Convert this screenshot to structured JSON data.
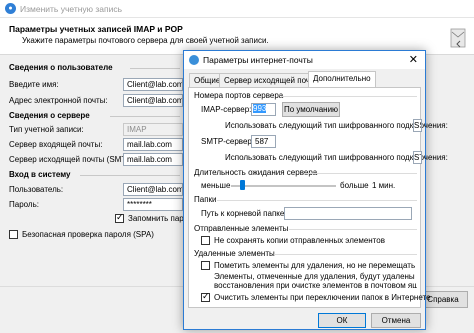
{
  "window": {
    "title": "Изменить учетную запись",
    "header_title": "Параметры учетных записей IMAP и POP",
    "header_subtitle": "Укажите параметры почтового сервера для своей учетной записи."
  },
  "user_section": {
    "heading": "Сведения о пользователе",
    "name_label": "Введите имя:",
    "name_value": "Client@lab.com",
    "email_label": "Адрес электронной почты:",
    "email_value": "Client@lab.com"
  },
  "server_section": {
    "heading": "Сведения о сервере",
    "type_label": "Тип учетной записи:",
    "type_value": "IMAP",
    "incoming_label": "Сервер входящей почты:",
    "incoming_value": "mail.lab.com",
    "outgoing_label": "Сервер исходящей почты (SMTP):",
    "outgoing_value": "mail.lab.com"
  },
  "login_section": {
    "heading": "Вход в систему",
    "user_label": "Пользователь:",
    "user_value": "Client@lab.com",
    "password_label": "Пароль:",
    "password_value": "********",
    "remember_label": "Запомнить пароль",
    "spa_label": "Безопасная проверка пароля (SPA)"
  },
  "footer": {
    "help_label": "Справка"
  },
  "dialog": {
    "title": "Параметры интернет-почты",
    "close": "✕",
    "tabs": [
      "Общие",
      "Сервер исходящей почты",
      "Дополнительно"
    ],
    "ports_group": "Номера портов сервера",
    "imap_label": "IMAP-сервер:",
    "imap_value": "993",
    "default_button": "По умолчанию",
    "enc_label_1": "Использовать следующий тип шифрованного подключения:",
    "enc_value_1": "SS",
    "smtp_label": "SMTP-сервер:",
    "smtp_value": "587",
    "enc_label_2": "Использовать следующий тип шифрованного подключения:",
    "enc_value_2": "ST",
    "timeout_group": "Длительность ожидания сервера",
    "timeout_less": "меньше",
    "timeout_more": "больше",
    "timeout_value": "1 мин.",
    "timeout_level": 0.1,
    "folders_group": "Папки",
    "root_folder_label": "Путь к корневой папке:",
    "sent_group": "Отправленные элементы",
    "sent_checkbox": "Не сохранять копии отправленных элементов",
    "deleted_group": "Удаленные элементы",
    "deleted_checkbox_1": "Пометить элементы для удаления, но не перемещать их автоматич",
    "deleted_note_1": "Элементы, отмеченные для удаления, будут удалены без возмо",
    "deleted_note_2": "восстановления при очистке элементов в почтовом ящике.",
    "deleted_checkbox_2": "Очистить элементы при переключении папок в Интернете",
    "ok_label": "ОК",
    "cancel_label": "Отмена"
  }
}
